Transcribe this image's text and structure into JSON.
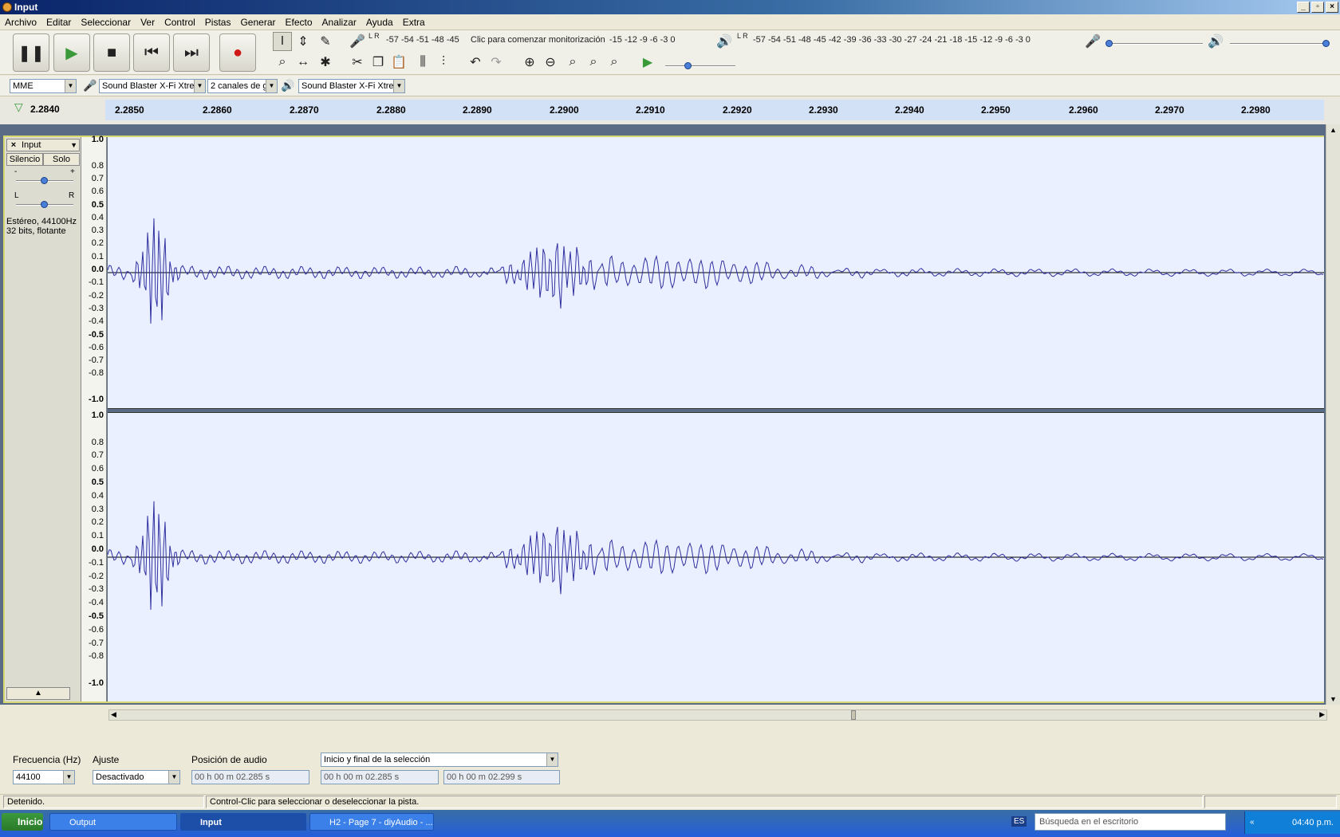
{
  "window": {
    "title": "Input"
  },
  "menu": [
    "Archivo",
    "Editar",
    "Seleccionar",
    "Ver",
    "Control",
    "Pistas",
    "Generar",
    "Efecto",
    "Analizar",
    "Ayuda",
    "Extra"
  ],
  "transport": {
    "pause": "pause-icon",
    "play": "play-icon",
    "stop": "stop-icon",
    "skip_start": "skip-start-icon",
    "skip_end": "skip-end-icon",
    "record": "record-icon"
  },
  "meters": {
    "rec_label": "L R",
    "rec_scale_left": "-57 -54 -51 -48 -45",
    "rec_prompt": "Clic para comenzar monitorización",
    "rec_scale_right": "-15 -12  -9  -6  -3  0",
    "play_scale": "-57 -54 -51 -48 -45 -42 -39 -36 -33 -30 -27 -24 -21 -18 -15 -12  -9  -6  -3  0"
  },
  "device": {
    "host": "MME",
    "input": "Sound Blaster X-Fi Xtrem",
    "channels": "2 canales de g",
    "output": "Sound Blaster X-Fi Xtrem"
  },
  "timeline": {
    "cursor": "2.2840",
    "ticks": [
      "2.2850",
      "2.2860",
      "2.2870",
      "2.2880",
      "2.2890",
      "2.2900",
      "2.2910",
      "2.2920",
      "2.2930",
      "2.2940",
      "2.2950",
      "2.2960",
      "2.2970",
      "2.2980"
    ]
  },
  "track": {
    "name": "Input",
    "mute": "Silencio",
    "solo": "Solo",
    "gain_minus": "-",
    "gain_plus": "+",
    "pan_left": "L",
    "pan_right": "R",
    "info_line1": "Estéreo, 44100Hz",
    "info_line2": "32 bits, flotante",
    "scale": [
      "1.0",
      "0.8",
      "0.7",
      "0.6",
      "0.5",
      "0.4",
      "0.3",
      "0.2",
      "0.1",
      "0.0",
      "-0.1",
      "-0.2",
      "-0.3",
      "-0.4",
      "-0.5",
      "-0.6",
      "-0.7",
      "-0.8",
      "-1.0"
    ]
  },
  "selection": {
    "rate_label": "Frecuencia (Hz)",
    "rate_value": "44100",
    "snap_label": "Ajuste",
    "snap_value": "Desactivado",
    "audio_pos_label": "Posición de audio",
    "audio_pos": "00 h 00 m 02.285 s",
    "sel_mode": "Inicio y final de la selección",
    "sel_start": "00 h 00 m 02.285 s",
    "sel_end": "00 h 00 m 02.299 s"
  },
  "status": {
    "state": "Detenido.",
    "hint": "Control-Clic para seleccionar o deseleccionar la pista."
  },
  "taskbar": {
    "start": "Inicio",
    "items": [
      "Output",
      "Input",
      "H2 - Page 7 - diyAudio - ..."
    ],
    "lang": "ES",
    "search": "Búsqueda en el escritorio",
    "clock": "04:40 p.m."
  }
}
